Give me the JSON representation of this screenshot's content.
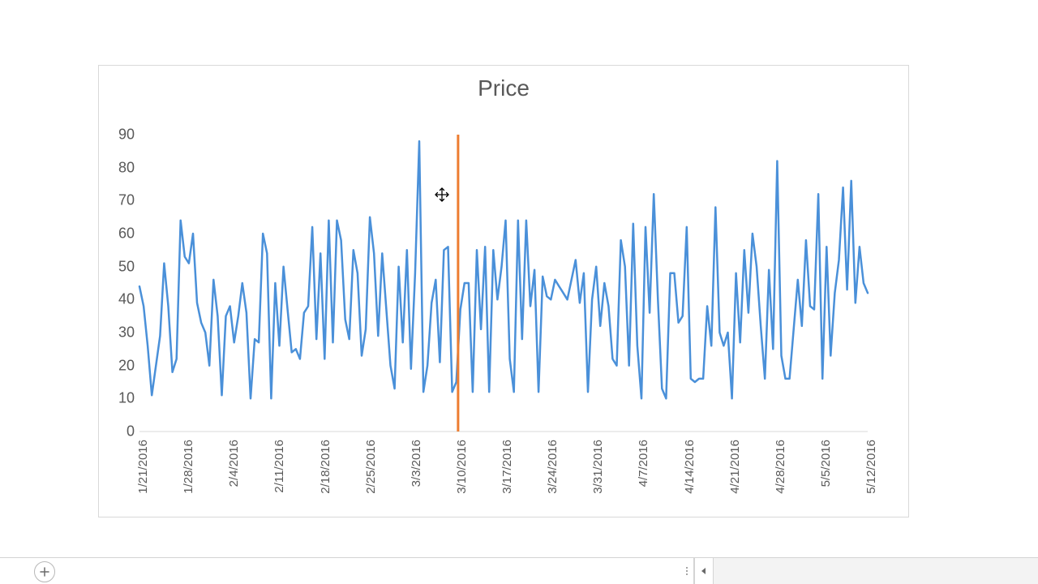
{
  "chart_data": {
    "type": "line",
    "title": "Price",
    "xlabel": "",
    "ylabel": "",
    "ylim": [
      0,
      90
    ],
    "y_ticks": [
      0,
      10,
      20,
      30,
      40,
      50,
      60,
      70,
      80,
      90
    ],
    "x_tick_labels": [
      "1/21/2016",
      "1/28/2016",
      "2/4/2016",
      "2/11/2016",
      "2/18/2016",
      "2/25/2016",
      "3/3/2016",
      "3/10/2016",
      "3/17/2016",
      "3/24/2016",
      "3/31/2016",
      "4/7/2016",
      "4/14/2016",
      "4/21/2016",
      "4/28/2016",
      "5/5/2016",
      "5/12/2016"
    ],
    "divider_x_label": "3/10/2016",
    "series": [
      {
        "name": "Price",
        "color": "#4A90D9",
        "values": [
          44,
          38,
          26,
          11,
          20,
          29,
          51,
          38,
          18,
          22,
          64,
          53,
          51,
          60,
          39,
          33,
          30,
          20,
          46,
          35,
          11,
          35,
          38,
          27,
          35,
          45,
          36,
          10,
          28,
          27,
          60,
          54,
          10,
          45,
          26,
          50,
          37,
          24,
          25,
          22,
          36,
          38,
          62,
          28,
          54,
          22,
          64,
          27,
          64,
          58,
          34,
          28,
          55,
          48,
          23,
          31,
          65,
          54,
          29,
          54,
          37,
          20,
          13,
          50,
          27,
          55,
          19,
          48,
          88,
          12,
          20,
          39,
          46,
          21,
          55,
          56,
          12,
          15,
          37,
          45,
          45,
          12,
          55,
          31,
          56,
          12,
          55,
          40,
          50,
          64,
          22,
          12,
          64,
          28,
          64,
          38,
          49,
          12,
          47,
          41,
          40,
          46,
          44,
          42,
          40,
          46,
          52,
          39,
          48,
          12,
          40,
          50,
          32,
          45,
          38,
          22,
          20,
          58,
          50,
          20,
          63,
          26,
          10,
          62,
          36,
          72,
          40,
          13,
          10,
          48,
          48,
          33,
          35,
          62,
          16,
          15,
          16,
          16,
          38,
          26,
          68,
          30,
          26,
          30,
          10,
          48,
          27,
          55,
          36,
          60,
          50,
          32,
          16,
          49,
          25,
          82,
          23,
          16,
          16,
          31,
          46,
          32,
          58,
          38,
          37,
          72,
          16,
          56,
          23,
          42,
          52,
          74,
          43,
          76,
          39,
          56,
          45,
          42
        ]
      }
    ]
  },
  "colors": {
    "line": "#4A90D9",
    "divider": "#ED7D31",
    "axis": "#d9d9d9",
    "text": "#595959"
  },
  "bottom_bar": {
    "add_sheet_tooltip": "New sheet"
  }
}
